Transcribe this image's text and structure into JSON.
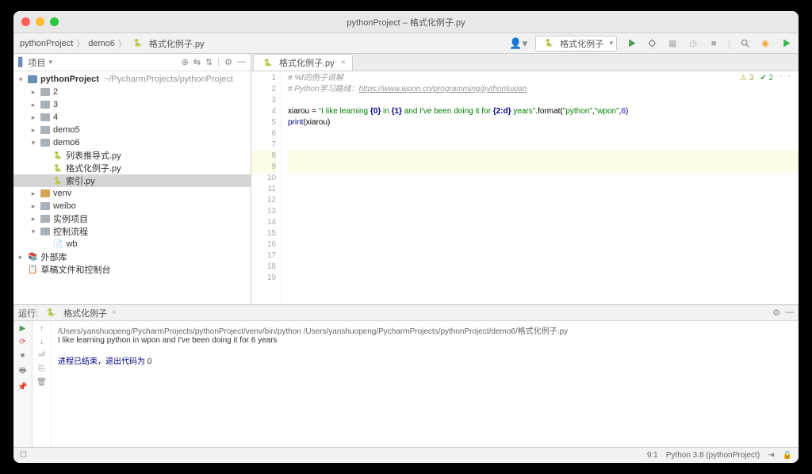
{
  "window": {
    "title": "pythonProject – 格式化例子.py"
  },
  "breadcrumb": [
    "pythonProject",
    "demo6",
    "格式化例子.py"
  ],
  "run_config": "格式化例子",
  "sidebar": {
    "header_label": "项目",
    "tree": [
      {
        "label": "pythonProject",
        "type": "project",
        "arrow": "▾",
        "hint": "~/PycharmProjects/pythonProject",
        "depth": 0
      },
      {
        "label": "2",
        "type": "folder",
        "arrow": "▸",
        "depth": 1
      },
      {
        "label": "3",
        "type": "folder",
        "arrow": "▸",
        "depth": 1
      },
      {
        "label": "4",
        "type": "folder",
        "arrow": "▸",
        "depth": 1
      },
      {
        "label": "demo5",
        "type": "folder",
        "arrow": "▸",
        "depth": 1
      },
      {
        "label": "demo6",
        "type": "folder",
        "arrow": "▾",
        "depth": 1
      },
      {
        "label": "列表推导式.py",
        "type": "py",
        "depth": 2
      },
      {
        "label": "格式化例子.py",
        "type": "py",
        "depth": 2
      },
      {
        "label": "索引.py",
        "type": "py",
        "depth": 2,
        "selected": true
      },
      {
        "label": "venv",
        "type": "venv",
        "arrow": "▸",
        "depth": 1
      },
      {
        "label": "weibo",
        "type": "folder",
        "arrow": "▸",
        "depth": 1
      },
      {
        "label": "实例项目",
        "type": "folder",
        "arrow": "▸",
        "depth": 1
      },
      {
        "label": "控制流程",
        "type": "folder",
        "arrow": "▾",
        "depth": 1
      },
      {
        "label": "wb",
        "type": "file",
        "depth": 2
      },
      {
        "label": "外部库",
        "type": "lib",
        "arrow": "▸",
        "depth": 0
      },
      {
        "label": "草稿文件和控制台",
        "type": "scratch",
        "depth": 0
      }
    ]
  },
  "editor": {
    "tab": "格式化例子.py",
    "badges": {
      "warn": "3",
      "ok": "2"
    },
    "lines": [
      {
        "n": 1,
        "type": "comment",
        "text": "# %f的例子讲解"
      },
      {
        "n": 2,
        "type": "comment_link",
        "prefix": "# Python学习路线：",
        "link": "https://www.wpon.cn/programming/pythonluxian"
      },
      {
        "n": 3,
        "type": "blank"
      },
      {
        "n": 4,
        "type": "code4"
      },
      {
        "n": 5,
        "type": "code5"
      },
      {
        "n": 6,
        "type": "blank"
      },
      {
        "n": 7,
        "type": "blank"
      },
      {
        "n": 8,
        "type": "blank",
        "hl": true
      },
      {
        "n": 9,
        "type": "blank",
        "hl": true
      },
      {
        "n": 10,
        "type": "blank"
      },
      {
        "n": 11,
        "type": "blank"
      },
      {
        "n": 12,
        "type": "blank"
      },
      {
        "n": 13,
        "type": "blank"
      },
      {
        "n": 14,
        "type": "blank"
      },
      {
        "n": 15,
        "type": "blank"
      },
      {
        "n": 16,
        "type": "blank"
      },
      {
        "n": 17,
        "type": "blank"
      },
      {
        "n": 18,
        "type": "blank"
      },
      {
        "n": 19,
        "type": "blank"
      }
    ],
    "tokens4": {
      "var": "xiarou ",
      "eq": "= ",
      "s1": "\"I like learning ",
      "f1": "{0}",
      "s2": " in ",
      "f2": "{1}",
      "s3": " and I've been doing it for ",
      "f3": "{2:d}",
      "s4": " years\"",
      "dot": ".",
      "method": "format",
      "p1": "(",
      "a1": "\"python\"",
      "c1": ",",
      "a2": "\"wpon\"",
      "c2": ",",
      "a3": "6",
      "p2": ")"
    },
    "tokens5": {
      "fn": "print",
      "p1": "(",
      "arg": "xiarou",
      "p2": ")"
    }
  },
  "console": {
    "header_label": "运行:",
    "tab": "格式化例子",
    "cmd": "/Users/yanshuopeng/PycharmProjects/pythonProject/venv/bin/python /Users/yanshuopeng/PycharmProjects/pythonProject/demo6/格式化例子.py",
    "output": "I like learning python in wpon and I've been doing it for 6 years",
    "exit_label": "进程已结束，退出代码为 ",
    "exit_code": "0"
  },
  "status": {
    "pos": "9:1",
    "interpreter": "Python 3.8 (pythonProject)"
  }
}
